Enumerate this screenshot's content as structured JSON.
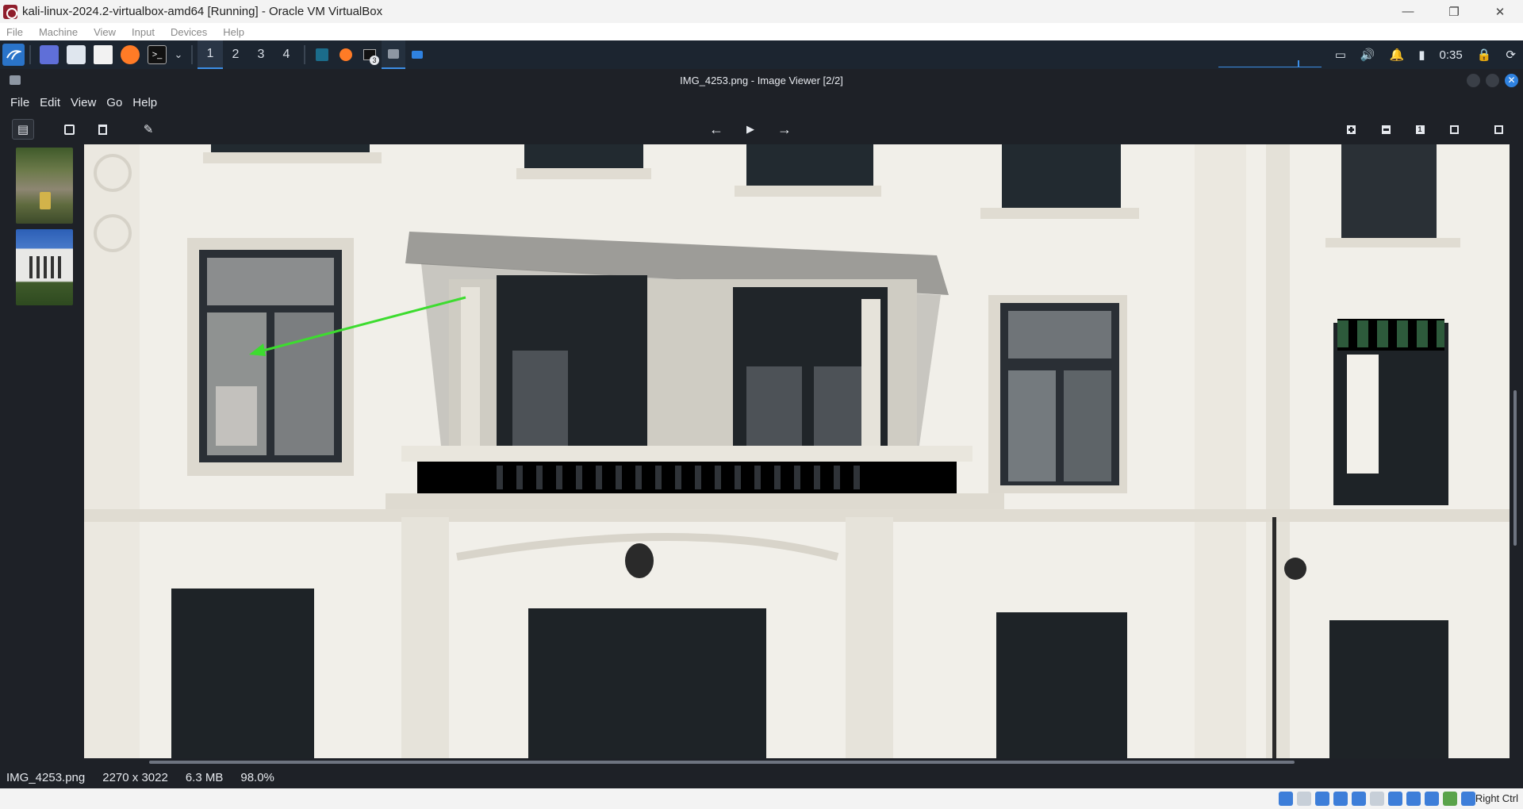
{
  "host": {
    "title": "kali-linux-2024.2-virtualbox-amd64 [Running] - Oracle VM VirtualBox",
    "menu": [
      "File",
      "Machine",
      "View",
      "Input",
      "Devices",
      "Help"
    ],
    "window_controls": {
      "minimize": "—",
      "restore": "❐",
      "close": "✕"
    },
    "host_key": "Right Ctrl"
  },
  "panel": {
    "workspaces": [
      "1",
      "2",
      "3",
      "4"
    ],
    "active_workspace": "1",
    "terminal_badge": "3",
    "clock": "0:35"
  },
  "viewer": {
    "title": "IMG_4253.png - Image Viewer [2/2]",
    "menu": [
      "File",
      "Edit",
      "View",
      "Go",
      "Help"
    ],
    "toolbar": {
      "open_icon": "▤",
      "save_icon": "💾",
      "delete_icon": "🗑",
      "edit_icon": "✎",
      "prev_icon": "←",
      "play_icon": "▶",
      "next_icon": "→",
      "zoom_in_icon": "⊞",
      "zoom_out_icon": "⊟",
      "actual_size_icon": "1",
      "fit_icon": "⛶",
      "fullscreen_icon": "⤢"
    },
    "status": {
      "filename": "IMG_4253.png",
      "dimensions": "2270 x 3022",
      "size": "6.3 MB",
      "zoom": "98.0%"
    }
  },
  "colors": {
    "accent": "#3c8ee6",
    "arrow": "#3ddc2f",
    "facade": "#f1efe9"
  }
}
